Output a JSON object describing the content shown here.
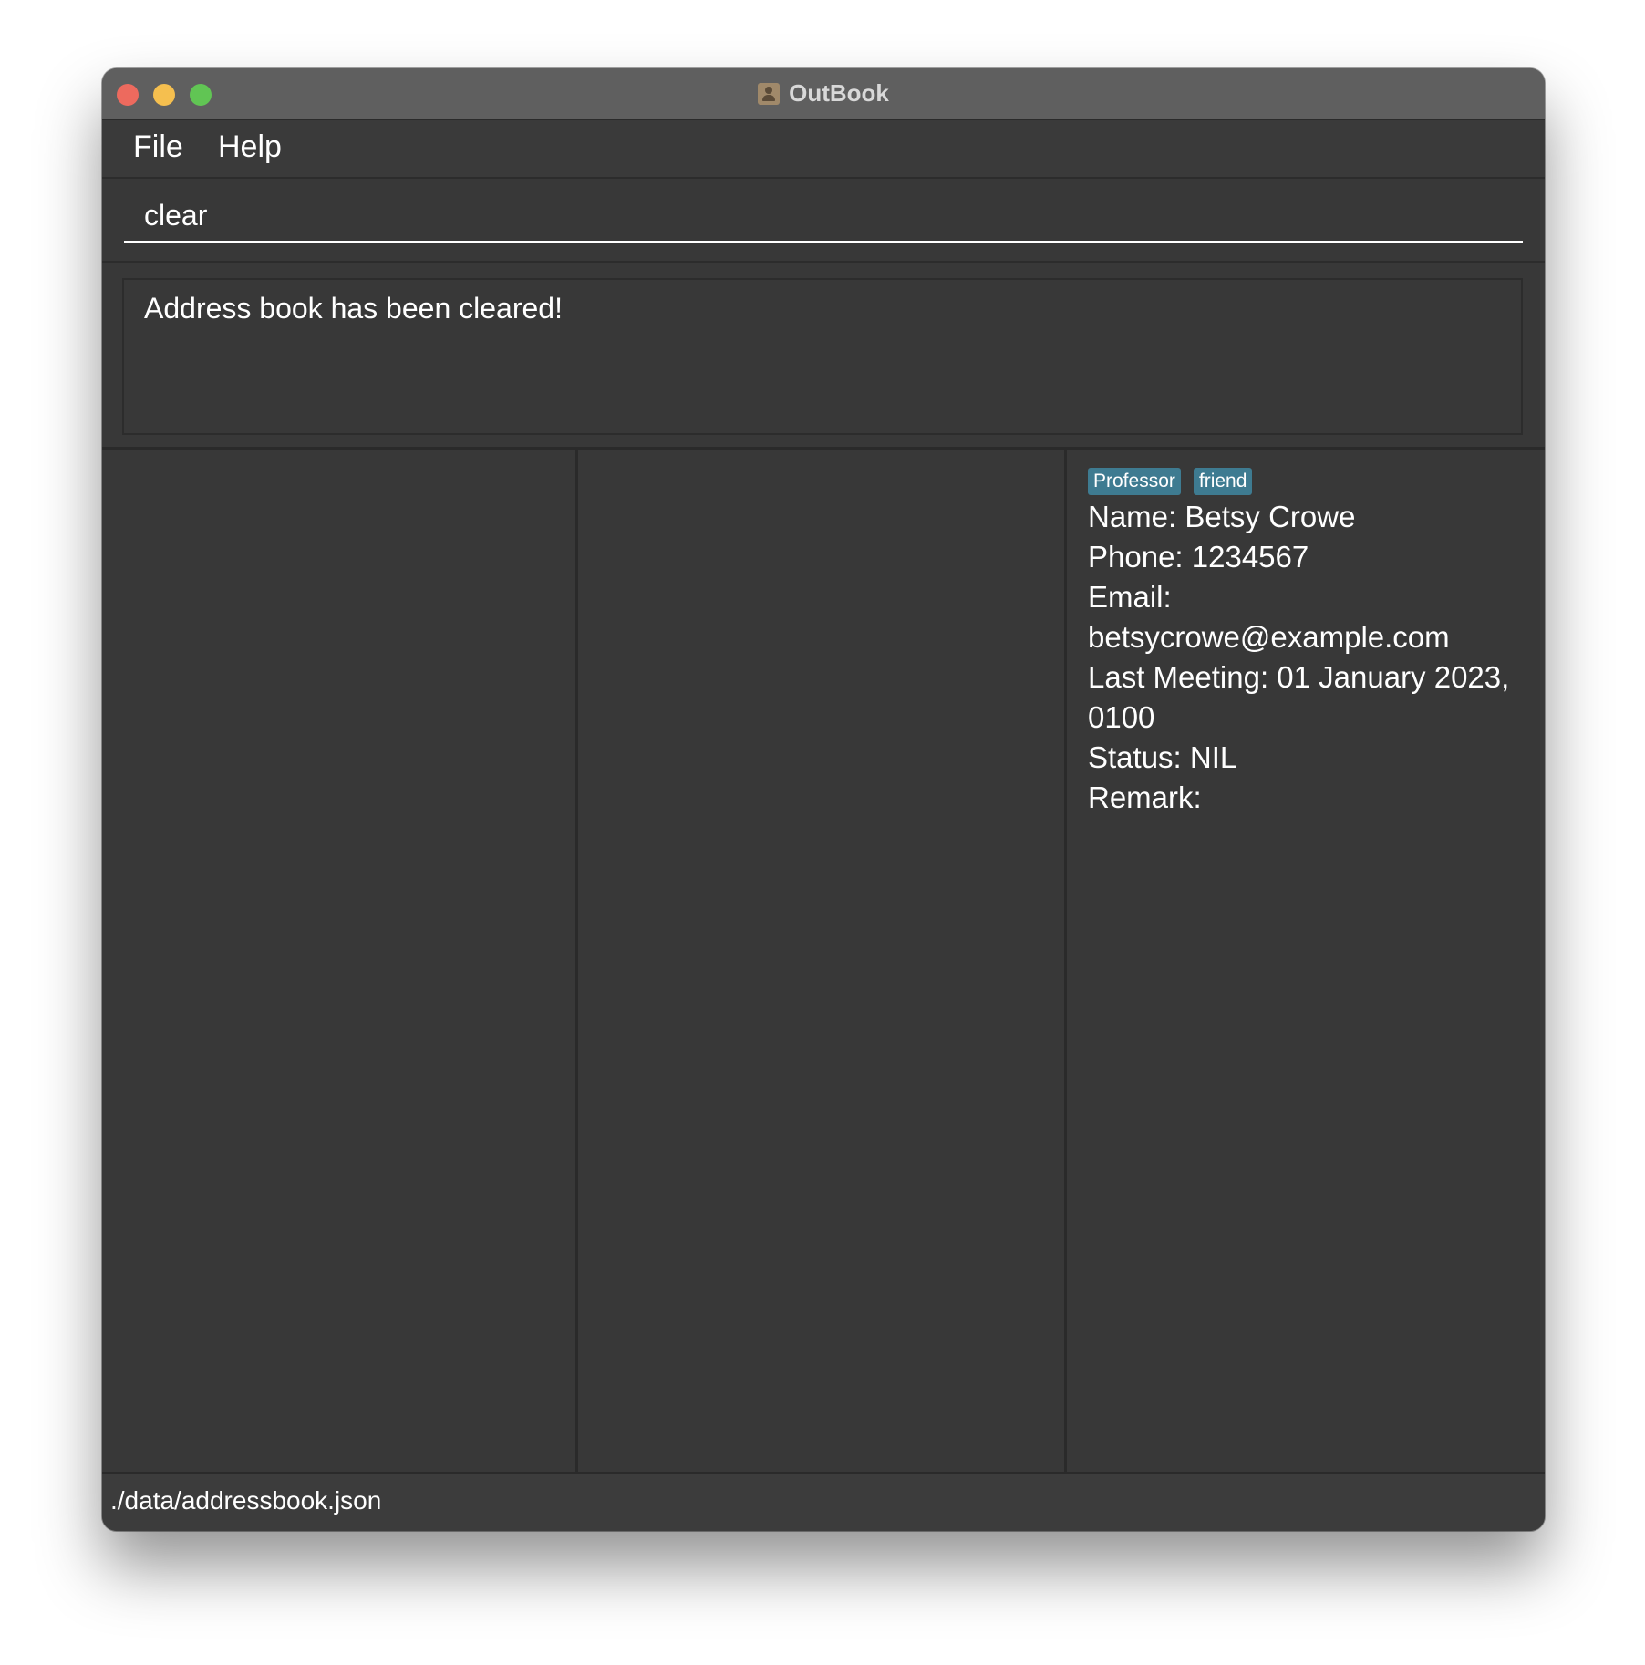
{
  "window": {
    "title": "OutBook",
    "app_icon": "address-book-icon"
  },
  "menu": {
    "items": [
      {
        "label": "File"
      },
      {
        "label": "Help"
      }
    ]
  },
  "command": {
    "value": "clear"
  },
  "result": {
    "message": "Address book has been cleared!"
  },
  "person_detail": {
    "tags": [
      "Professor",
      "friend"
    ],
    "name_line": "Name: Betsy Crowe",
    "phone_line": "Phone: 1234567",
    "email_label": "Email:",
    "email_value": "betsycrowe@example.com",
    "meeting_line1": "Last Meeting: 01 January 2023,",
    "meeting_line2": "0100",
    "status_line": "Status: NIL",
    "remark_line": "Remark:"
  },
  "statusbar": {
    "path": "./data/addressbook.json"
  },
  "colors": {
    "background": "#383838",
    "titlebar": "#5f5f5f",
    "tag": "#3e7b91",
    "close": "#ed6a5e",
    "minimize": "#f5bf4f",
    "maximize": "#61c554"
  }
}
